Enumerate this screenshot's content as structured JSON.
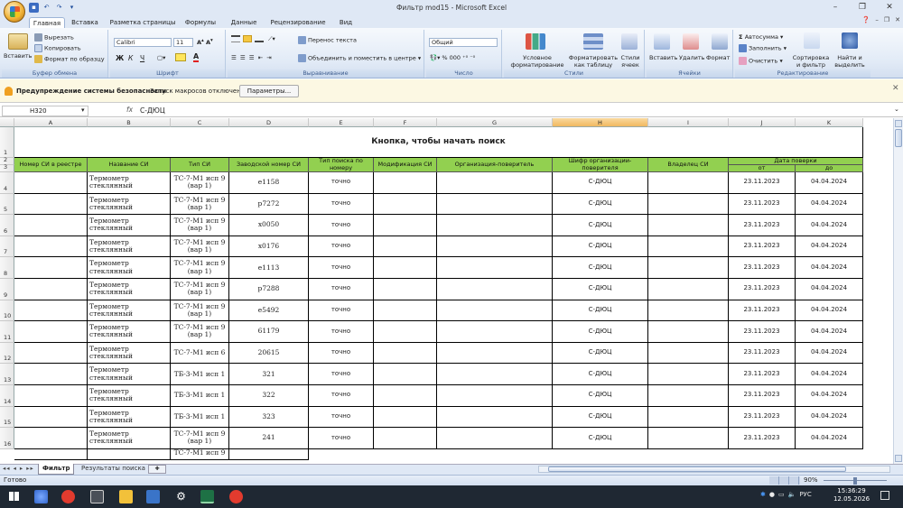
{
  "window": {
    "title": "Фильтр mod15 - Microsoft Excel"
  },
  "tabs": [
    "Главная",
    "Вставка",
    "Разметка страницы",
    "Формулы",
    "Данные",
    "Рецензирование",
    "Вид"
  ],
  "ribbon": {
    "clipboard": {
      "paste": "Вставить",
      "cut": "Вырезать",
      "copy": "Копировать",
      "format_painter": "Формат по образцу",
      "label": "Буфер обмена"
    },
    "font": {
      "name": "Calibri",
      "size": "11",
      "label": "Шрифт",
      "bold": "Ж",
      "italic": "К",
      "underline": "Ч"
    },
    "alignment": {
      "wrap": "Перенос текста",
      "merge": "Объединить и поместить в центре",
      "label": "Выравнивание"
    },
    "number": {
      "format": "Общий",
      "label": "Число"
    },
    "styles": {
      "conditional": "Условное форматирование",
      "as_table": "Форматировать как таблицу",
      "cell_styles": "Стили ячеек",
      "label": "Стили"
    },
    "cells": {
      "insert": "Вставить",
      "delete": "Удалить",
      "format": "Формат",
      "label": "Ячейки"
    },
    "editing": {
      "autosum": "Автосумма",
      "fill": "Заполнить",
      "clear": "Очистить",
      "sort": "Сортировка и фильтр",
      "find": "Найти и выделить",
      "label": "Редактирование"
    }
  },
  "security": {
    "title": "Предупреждение системы безопасности",
    "message": "Запуск макросов отключен.",
    "button": "Параметры..."
  },
  "formula_bar": {
    "name_box": "H320",
    "fx": "fx",
    "content": "С-ДЮЦ"
  },
  "columns": [
    "A",
    "B",
    "C",
    "D",
    "E",
    "F",
    "G",
    "H",
    "I",
    "J",
    "K"
  ],
  "sheet": {
    "banner": "Кнопка, чтобы начать поиск",
    "headers": [
      "Номер СИ в реестре",
      "Название СИ",
      "Тип СИ",
      "Заводской номер СИ",
      "Тип поиска по номеру",
      "Модификация СИ",
      "Организация-поверитель",
      "Шифр организации-поверителя",
      "Владелец СИ"
    ],
    "date_header": "Дата поверки",
    "date_from": "от",
    "date_to": "до",
    "row_numbers": [
      "1",
      "2",
      "3",
      "4",
      "5",
      "6",
      "7",
      "8",
      "9",
      "10",
      "11",
      "12",
      "13",
      "14",
      "15",
      "16"
    ],
    "rows": [
      {
        "name": "Термометр стеклянный",
        "type": "ТС-7-М1 исп 9 (вар 1)",
        "serial": "е1158",
        "search": "точно",
        "cipher": "С-ДЮЦ",
        "from": "23.11.2023",
        "to": "04.04.2024"
      },
      {
        "name": "Термометр стеклянный",
        "type": "ТС-7-М1 исп 9 (вар 1)",
        "serial": "р7272",
        "search": "точно",
        "cipher": "С-ДЮЦ",
        "from": "23.11.2023",
        "to": "04.04.2024"
      },
      {
        "name": "Термометр стеклянный",
        "type": "ТС-7-М1 исп 9 (вар 1)",
        "serial": "х0050",
        "search": "точно",
        "cipher": "С-ДЮЦ",
        "from": "23.11.2023",
        "to": "04.04.2024"
      },
      {
        "name": "Термометр стеклянный",
        "type": "ТС-7-М1 исп 9 (вар 1)",
        "serial": "х0176",
        "search": "точно",
        "cipher": "С-ДЮЦ",
        "from": "23.11.2023",
        "to": "04.04.2024"
      },
      {
        "name": "Термометр стеклянный",
        "type": "ТС-7-М1 исп 9 (вар 1)",
        "serial": "е1113",
        "search": "точно",
        "cipher": "С-ДЮЦ",
        "from": "23.11.2023",
        "to": "04.04.2024"
      },
      {
        "name": "Термометр стеклянный",
        "type": "ТС-7-М1 исп 9 (вар 1)",
        "serial": "р7288",
        "search": "точно",
        "cipher": "С-ДЮЦ",
        "from": "23.11.2023",
        "to": "04.04.2024"
      },
      {
        "name": "Термометр стеклянный",
        "type": "ТС-7-М1 исп 9 (вар 1)",
        "serial": "е5492",
        "search": "точно",
        "cipher": "С-ДЮЦ",
        "from": "23.11.2023",
        "to": "04.04.2024"
      },
      {
        "name": "Термометр стеклянный",
        "type": "ТС-7-М1 исп 9 (вар 1)",
        "serial": "61179",
        "search": "точно",
        "cipher": "С-ДЮЦ",
        "from": "23.11.2023",
        "to": "04.04.2024"
      },
      {
        "name": "Термометр стеклянный",
        "type": "ТС-7-М1 исп 6",
        "serial": "20615",
        "search": "точно",
        "cipher": "С-ДЮЦ",
        "from": "23.11.2023",
        "to": "04.04.2024"
      },
      {
        "name": "Термометр стеклянный",
        "type": "ТБ-3-М1 исп 1",
        "serial": "321",
        "search": "точно",
        "cipher": "С-ДЮЦ",
        "from": "23.11.2023",
        "to": "04.04.2024"
      },
      {
        "name": "Термометр стеклянный",
        "type": "ТБ-3-М1 исп 1",
        "serial": "322",
        "search": "точно",
        "cipher": "С-ДЮЦ",
        "from": "23.11.2023",
        "to": "04.04.2024"
      },
      {
        "name": "Термометр стеклянный",
        "type": "ТБ-3-М1 исп 1",
        "serial": "323",
        "search": "точно",
        "cipher": "С-ДЮЦ",
        "from": "23.11.2023",
        "to": "04.04.2024"
      },
      {
        "name": "Термометр стеклянный",
        "type": "ТС-7-М1 исп 9 (вар 1)",
        "serial": "241",
        "search": "точно",
        "cipher": "С-ДЮЦ",
        "from": "23.11.2023",
        "to": "04.04.2024"
      }
    ],
    "partial_type": "ТС-7-М1 исп 9"
  },
  "sheet_tabs": [
    "Фильтр",
    "Результаты поиска"
  ],
  "status": {
    "ready": "Готово",
    "zoom": "90%"
  },
  "tray": {
    "lang": "РУС",
    "time": "15:36:29",
    "date": "12.05.2026"
  }
}
